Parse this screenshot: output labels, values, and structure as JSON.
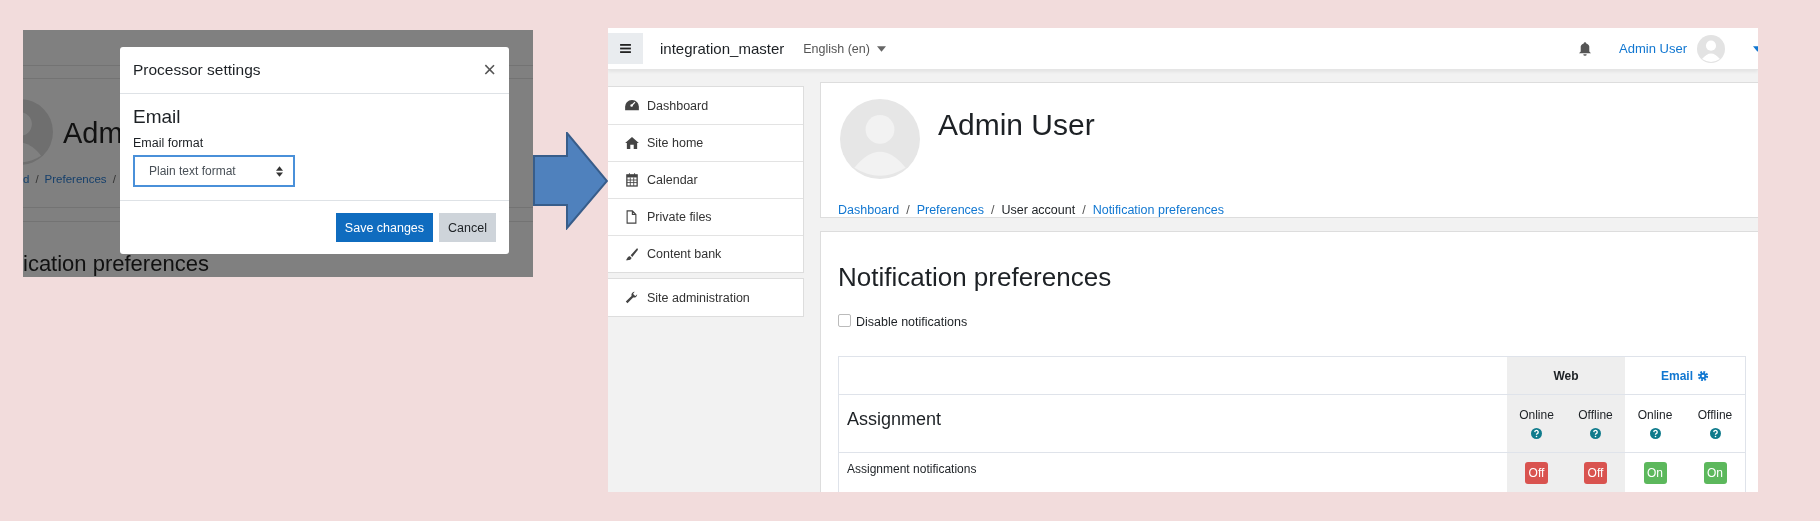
{
  "left_screenshot": {
    "background": {
      "heading_fragment": "Adm",
      "breadcrumb": [
        {
          "label": "d",
          "separator": "/"
        },
        {
          "label": "Preferences",
          "separator": "/"
        }
      ],
      "section_heading_fragment": "ication preferences"
    },
    "dialog": {
      "title": "Processor settings",
      "close": "×",
      "section": "Email",
      "field_label": "Email format",
      "select_value": "Plain text format",
      "focused": true,
      "buttons": [
        {
          "label": "Save changes",
          "kind": "primary"
        },
        {
          "label": "Cancel",
          "kind": "secondary"
        }
      ]
    }
  },
  "right_screenshot": {
    "navbar": {
      "site_name": "integration_master",
      "language": "English (en)",
      "user": "Admin User"
    },
    "sidebar": {
      "groups": [
        {
          "items": [
            {
              "label": "Dashboard"
            },
            {
              "label": "Site home"
            },
            {
              "label": "Calendar"
            },
            {
              "label": "Private files"
            },
            {
              "label": "Content bank"
            }
          ]
        },
        {
          "items": [
            {
              "label": "Site administration"
            }
          ]
        }
      ]
    },
    "profile": {
      "name": "Admin User",
      "breadcrumb": [
        {
          "label": "Dashboard",
          "link": true,
          "separator": "/"
        },
        {
          "label": "Preferences",
          "link": true,
          "separator": "/"
        },
        {
          "label": "User account",
          "link": false,
          "separator": "/"
        },
        {
          "label": "Notification preferences",
          "link": true
        }
      ]
    },
    "notifications": {
      "title": "Notification preferences",
      "disable": {
        "label": "Disable notifications",
        "checked": false
      },
      "processors": [
        {
          "name": "Web",
          "configurable": false,
          "shaded": true
        },
        {
          "name": "Email",
          "configurable": true,
          "shaded": false
        }
      ],
      "states": [
        "Online",
        "Offline",
        "Online",
        "Offline"
      ],
      "section": "Assignment",
      "rows": [
        {
          "label": "Assignment notifications",
          "toggles": [
            {
              "label": "Off",
              "on": false
            },
            {
              "label": "Off",
              "on": false
            },
            {
              "label": "On",
              "on": true
            },
            {
              "label": "On",
              "on": true
            }
          ]
        }
      ]
    }
  }
}
